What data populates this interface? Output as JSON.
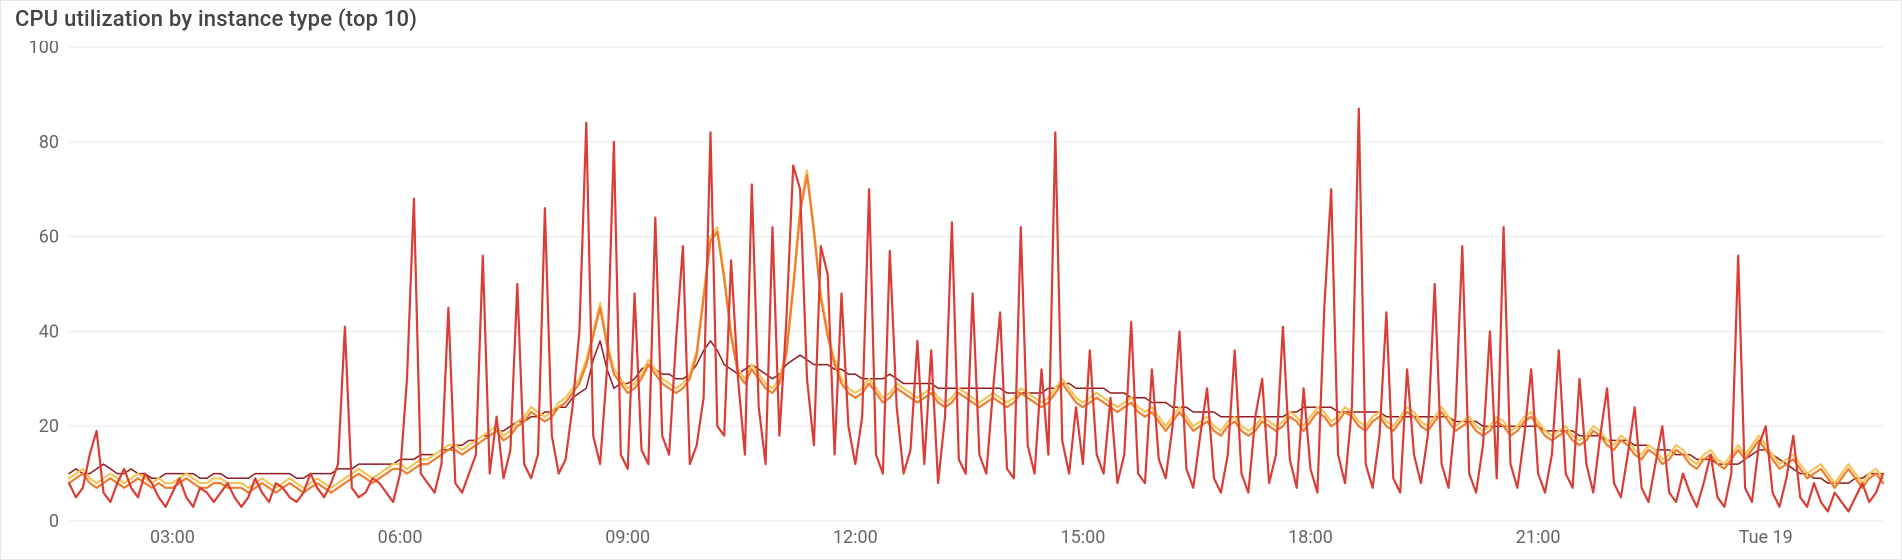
{
  "panel": {
    "title": "CPU utilization by instance type (top 10)"
  },
  "colors": {
    "grid": "#e9e9e9",
    "axis_text": "#666666",
    "series_dark_red": "#8f1d21",
    "series_red": "#d93e36",
    "series_orange": "#ef7f2f",
    "series_yellow": "#f5c55b"
  },
  "chart_data": {
    "type": "line",
    "title": "CPU utilization by instance type (top 10)",
    "xlabel": "",
    "ylabel": "",
    "ylim": [
      0,
      100
    ],
    "y_ticks": [
      0,
      20,
      40,
      60,
      80,
      100
    ],
    "x_tick_labels": [
      "03:00",
      "06:00",
      "09:00",
      "12:00",
      "15:00",
      "18:00",
      "21:00",
      "Tue 19"
    ],
    "x_tick_indices": [
      15,
      48,
      81,
      114,
      147,
      180,
      213,
      246
    ],
    "grid": true,
    "legend_position": "none",
    "x": [
      0,
      1,
      2,
      3,
      4,
      5,
      6,
      7,
      8,
      9,
      10,
      11,
      12,
      13,
      14,
      15,
      16,
      17,
      18,
      19,
      20,
      21,
      22,
      23,
      24,
      25,
      26,
      27,
      28,
      29,
      30,
      31,
      32,
      33,
      34,
      35,
      36,
      37,
      38,
      39,
      40,
      41,
      42,
      43,
      44,
      45,
      46,
      47,
      48,
      49,
      50,
      51,
      52,
      53,
      54,
      55,
      56,
      57,
      58,
      59,
      60,
      61,
      62,
      63,
      64,
      65,
      66,
      67,
      68,
      69,
      70,
      71,
      72,
      73,
      74,
      75,
      76,
      77,
      78,
      79,
      80,
      81,
      82,
      83,
      84,
      85,
      86,
      87,
      88,
      89,
      90,
      91,
      92,
      93,
      94,
      95,
      96,
      97,
      98,
      99,
      100,
      101,
      102,
      103,
      104,
      105,
      106,
      107,
      108,
      109,
      110,
      111,
      112,
      113,
      114,
      115,
      116,
      117,
      118,
      119,
      120,
      121,
      122,
      123,
      124,
      125,
      126,
      127,
      128,
      129,
      130,
      131,
      132,
      133,
      134,
      135,
      136,
      137,
      138,
      139,
      140,
      141,
      142,
      143,
      144,
      145,
      146,
      147,
      148,
      149,
      150,
      151,
      152,
      153,
      154,
      155,
      156,
      157,
      158,
      159,
      160,
      161,
      162,
      163,
      164,
      165,
      166,
      167,
      168,
      169,
      170,
      171,
      172,
      173,
      174,
      175,
      176,
      177,
      178,
      179,
      180,
      181,
      182,
      183,
      184,
      185,
      186,
      187,
      188,
      189,
      190,
      191,
      192,
      193,
      194,
      195,
      196,
      197,
      198,
      199,
      200,
      201,
      202,
      203,
      204,
      205,
      206,
      207,
      208,
      209,
      210,
      211,
      212,
      213,
      214,
      215,
      216,
      217,
      218,
      219,
      220,
      221,
      222,
      223,
      224,
      225,
      226,
      227,
      228,
      229,
      230,
      231,
      232,
      233,
      234,
      235,
      236,
      237,
      238,
      239,
      240,
      241,
      242,
      243,
      244,
      245,
      246,
      247,
      248,
      249,
      250,
      251,
      252,
      253,
      254,
      255,
      256,
      257,
      258,
      259,
      260,
      261,
      262,
      263
    ],
    "series": [
      {
        "name": "dark_red",
        "color": "#8f1d21",
        "weight": "thin",
        "values": [
          10,
          11,
          10,
          10,
          11,
          12,
          11,
          10,
          10,
          11,
          10,
          10,
          9,
          9,
          10,
          10,
          10,
          10,
          10,
          9,
          9,
          10,
          10,
          9,
          9,
          9,
          9,
          10,
          10,
          10,
          10,
          10,
          10,
          9,
          9,
          10,
          10,
          10,
          10,
          11,
          11,
          11,
          12,
          12,
          12,
          12,
          12,
          12,
          13,
          13,
          13,
          14,
          14,
          14,
          15,
          15,
          16,
          16,
          17,
          17,
          18,
          18,
          19,
          19,
          20,
          21,
          21,
          22,
          22,
          23,
          23,
          24,
          24,
          26,
          27,
          28,
          34,
          38,
          32,
          28,
          29,
          29,
          30,
          32,
          33,
          32,
          31,
          31,
          30,
          30,
          31,
          33,
          36,
          38,
          36,
          33,
          32,
          31,
          32,
          33,
          32,
          31,
          30,
          31,
          33,
          34,
          35,
          34,
          33,
          33,
          33,
          32,
          32,
          31,
          31,
          30,
          30,
          30,
          30,
          31,
          30,
          29,
          29,
          29,
          29,
          29,
          28,
          28,
          28,
          28,
          28,
          28,
          28,
          28,
          28,
          28,
          27,
          27,
          27,
          27,
          27,
          27,
          28,
          28,
          29,
          29,
          28,
          28,
          28,
          28,
          28,
          27,
          27,
          27,
          26,
          26,
          26,
          25,
          25,
          25,
          24,
          24,
          24,
          23,
          23,
          23,
          23,
          22,
          22,
          22,
          22,
          22,
          22,
          22,
          22,
          22,
          22,
          23,
          23,
          24,
          24,
          24,
          24,
          24,
          23,
          23,
          23,
          23,
          23,
          23,
          23,
          22,
          22,
          22,
          22,
          22,
          22,
          22,
          22,
          22,
          22,
          21,
          21,
          21,
          21,
          20,
          20,
          20,
          20,
          20,
          20,
          20,
          20,
          20,
          19,
          19,
          19,
          19,
          19,
          18,
          18,
          18,
          18,
          17,
          17,
          17,
          17,
          16,
          16,
          16,
          15,
          15,
          15,
          14,
          14,
          14,
          13,
          13,
          13,
          12,
          12,
          12,
          12,
          13,
          14,
          15,
          15,
          14,
          13,
          12,
          11,
          10,
          10,
          9,
          9,
          8,
          8,
          8,
          8,
          9,
          9,
          10,
          10,
          10
        ]
      },
      {
        "name": "yellow",
        "color": "#f5c55b",
        "weight": "thick",
        "values": [
          9,
          10,
          11,
          9,
          8,
          9,
          10,
          9,
          8,
          9,
          10,
          9,
          8,
          9,
          8,
          8,
          9,
          10,
          9,
          8,
          8,
          9,
          9,
          8,
          8,
          8,
          7,
          8,
          9,
          8,
          7,
          8,
          9,
          8,
          7,
          8,
          9,
          8,
          7,
          8,
          9,
          10,
          11,
          10,
          9,
          10,
          11,
          12,
          12,
          11,
          12,
          13,
          13,
          14,
          15,
          16,
          16,
          15,
          16,
          17,
          18,
          19,
          20,
          18,
          19,
          21,
          22,
          24,
          23,
          22,
          23,
          25,
          26,
          28,
          30,
          34,
          40,
          46,
          38,
          32,
          30,
          28,
          29,
          31,
          34,
          32,
          30,
          29,
          28,
          29,
          31,
          36,
          48,
          60,
          62,
          52,
          40,
          32,
          30,
          33,
          31,
          29,
          28,
          30,
          36,
          50,
          66,
          74,
          62,
          48,
          40,
          34,
          30,
          28,
          27,
          28,
          30,
          28,
          26,
          27,
          29,
          28,
          27,
          26,
          27,
          28,
          26,
          25,
          26,
          28,
          27,
          26,
          25,
          26,
          27,
          26,
          25,
          26,
          28,
          27,
          26,
          25,
          26,
          28,
          30,
          28,
          26,
          25,
          26,
          27,
          26,
          25,
          24,
          25,
          26,
          24,
          23,
          24,
          22,
          20,
          22,
          24,
          22,
          20,
          21,
          22,
          20,
          19,
          21,
          22,
          20,
          19,
          20,
          22,
          21,
          20,
          21,
          23,
          22,
          20,
          22,
          24,
          23,
          21,
          22,
          24,
          23,
          21,
          20,
          22,
          23,
          21,
          20,
          22,
          24,
          23,
          21,
          20,
          22,
          24,
          22,
          20,
          21,
          22,
          20,
          19,
          20,
          22,
          21,
          19,
          20,
          22,
          23,
          21,
          19,
          18,
          19,
          20,
          18,
          17,
          18,
          20,
          19,
          17,
          16,
          18,
          17,
          15,
          14,
          16,
          15,
          13,
          14,
          16,
          15,
          13,
          12,
          14,
          15,
          13,
          12,
          14,
          16,
          14,
          16,
          18,
          16,
          14,
          12,
          13,
          14,
          12,
          10,
          11,
          12,
          10,
          8,
          10,
          12,
          10,
          8,
          10,
          11,
          9
        ]
      },
      {
        "name": "orange",
        "color": "#ef7f2f",
        "weight": "thick",
        "values": [
          8,
          9,
          10,
          8,
          7,
          8,
          9,
          8,
          7,
          8,
          9,
          8,
          7,
          8,
          7,
          7,
          8,
          9,
          8,
          7,
          7,
          8,
          8,
          7,
          7,
          7,
          6,
          7,
          8,
          7,
          6,
          7,
          8,
          7,
          6,
          7,
          8,
          7,
          6,
          7,
          8,
          9,
          10,
          9,
          8,
          9,
          10,
          11,
          11,
          10,
          11,
          12,
          12,
          13,
          14,
          15,
          15,
          14,
          15,
          16,
          17,
          18,
          19,
          17,
          18,
          20,
          21,
          23,
          22,
          21,
          22,
          24,
          25,
          27,
          29,
          33,
          39,
          45,
          37,
          31,
          29,
          27,
          28,
          30,
          33,
          31,
          29,
          28,
          27,
          28,
          30,
          35,
          47,
          59,
          61,
          51,
          39,
          31,
          29,
          32,
          30,
          28,
          27,
          29,
          35,
          49,
          65,
          73,
          61,
          47,
          39,
          33,
          29,
          27,
          26,
          27,
          29,
          27,
          25,
          26,
          28,
          27,
          26,
          25,
          26,
          27,
          25,
          24,
          25,
          27,
          26,
          25,
          24,
          25,
          26,
          25,
          24,
          25,
          27,
          26,
          25,
          24,
          25,
          27,
          29,
          27,
          25,
          24,
          25,
          26,
          25,
          24,
          23,
          24,
          25,
          23,
          22,
          23,
          21,
          19,
          21,
          23,
          21,
          19,
          20,
          21,
          19,
          18,
          20,
          21,
          19,
          18,
          19,
          21,
          20,
          19,
          20,
          22,
          21,
          19,
          21,
          23,
          22,
          20,
          21,
          23,
          22,
          20,
          19,
          21,
          22,
          20,
          19,
          21,
          23,
          22,
          20,
          19,
          21,
          23,
          21,
          19,
          20,
          21,
          19,
          18,
          19,
          21,
          20,
          18,
          19,
          21,
          22,
          20,
          18,
          17,
          18,
          19,
          17,
          16,
          17,
          19,
          18,
          16,
          15,
          17,
          16,
          14,
          13,
          15,
          14,
          12,
          13,
          15,
          14,
          12,
          11,
          13,
          14,
          12,
          11,
          13,
          15,
          13,
          15,
          17,
          15,
          13,
          11,
          12,
          13,
          11,
          9,
          10,
          11,
          9,
          7,
          9,
          11,
          9,
          7,
          9,
          10,
          8
        ]
      },
      {
        "name": "red",
        "color": "#d93e36",
        "weight": "thick",
        "values": [
          8,
          5,
          7,
          14,
          19,
          6,
          4,
          8,
          11,
          7,
          5,
          10,
          8,
          5,
          3,
          6,
          9,
          5,
          3,
          7,
          6,
          4,
          6,
          8,
          5,
          3,
          5,
          9,
          6,
          4,
          8,
          7,
          5,
          4,
          6,
          10,
          7,
          5,
          8,
          12,
          41,
          7,
          5,
          6,
          9,
          8,
          6,
          4,
          10,
          30,
          68,
          10,
          8,
          6,
          12,
          45,
          8,
          6,
          10,
          14,
          56,
          10,
          22,
          9,
          15,
          50,
          12,
          9,
          14,
          66,
          18,
          10,
          13,
          24,
          40,
          84,
          18,
          12,
          32,
          80,
          14,
          11,
          48,
          15,
          12,
          64,
          18,
          14,
          38,
          58,
          12,
          16,
          26,
          82,
          20,
          18,
          55,
          30,
          14,
          71,
          24,
          12,
          62,
          18,
          42,
          75,
          70,
          30,
          16,
          58,
          52,
          14,
          48,
          20,
          12,
          22,
          70,
          14,
          10,
          57,
          24,
          10,
          15,
          38,
          12,
          36,
          8,
          22,
          63,
          13,
          10,
          48,
          14,
          10,
          28,
          44,
          11,
          9,
          62,
          16,
          10,
          32,
          14,
          82,
          17,
          10,
          24,
          12,
          36,
          14,
          10,
          26,
          8,
          14,
          42,
          10,
          8,
          32,
          13,
          9,
          20,
          40,
          11,
          7,
          18,
          28,
          9,
          6,
          14,
          36,
          10,
          6,
          22,
          30,
          8,
          14,
          41,
          13,
          7,
          28,
          11,
          6,
          45,
          70,
          14,
          8,
          24,
          87,
          12,
          7,
          18,
          44,
          9,
          6,
          32,
          14,
          8,
          18,
          50,
          12,
          7,
          22,
          58,
          10,
          6,
          16,
          40,
          9,
          62,
          12,
          7,
          18,
          32,
          10,
          6,
          14,
          36,
          10,
          7,
          30,
          12,
          6,
          18,
          28,
          8,
          5,
          14,
          24,
          7,
          4,
          12,
          20,
          6,
          4,
          10,
          6,
          3,
          8,
          14,
          5,
          3,
          10,
          56,
          7,
          4,
          16,
          20,
          6,
          3,
          9,
          18,
          5,
          3,
          8,
          4,
          2,
          6,
          4,
          2,
          5,
          8,
          4,
          6,
          10
        ]
      }
    ]
  }
}
